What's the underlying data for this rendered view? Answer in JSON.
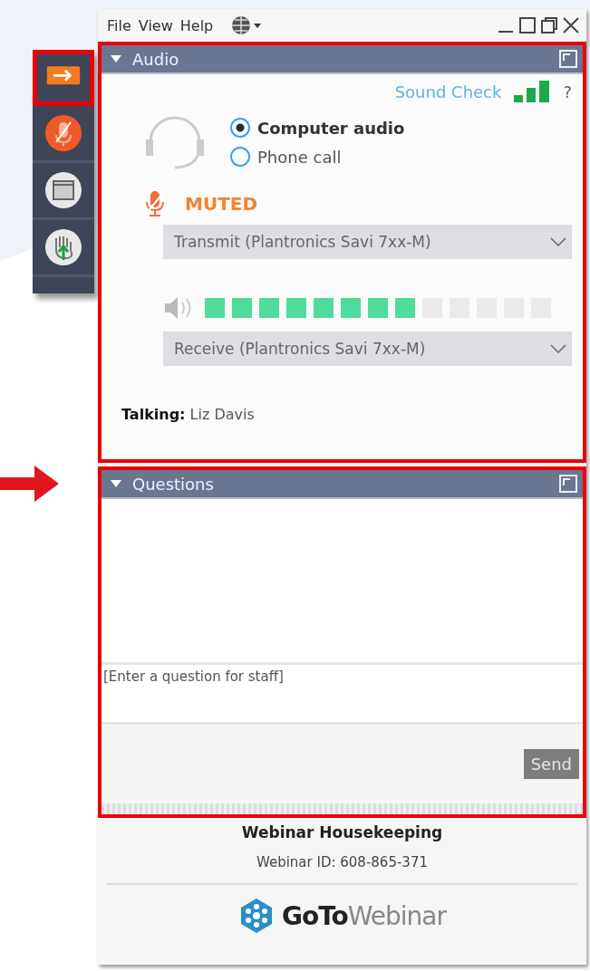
{
  "menu": [
    "File",
    "View",
    "Help"
  ],
  "sidebar": {
    "items": [
      {
        "kind": "arrow",
        "selected": true
      },
      {
        "kind": "mic"
      },
      {
        "kind": "screen"
      },
      {
        "kind": "hand"
      }
    ]
  },
  "audio": {
    "title": "Audio",
    "sound_check": "Sound Check",
    "help": "?",
    "options": [
      {
        "label": "Computer audio",
        "selected": true
      },
      {
        "label": "Phone call",
        "selected": false
      }
    ],
    "mic_status": "MUTED",
    "muted": true,
    "transmit": "Transmit (Plantronics Savi 7xx-M)",
    "speaker_meter": {
      "level": 0.615
    },
    "receive": "Receive (Plantronics Savi 7xx-M)",
    "talking": "**Talking:** Liz Davis"
  },
  "questions": {
    "title": "Questions",
    "placeholder": "[Enter a question for staff]",
    "send": {
      "label": "Send",
      "disabled": true
    }
  },
  "footer": {
    "title": "Webinar Housekeeping",
    "webinar_id": "Webinar ID: 608-865-371",
    "logo": "**GoTo**Webinar"
  }
}
